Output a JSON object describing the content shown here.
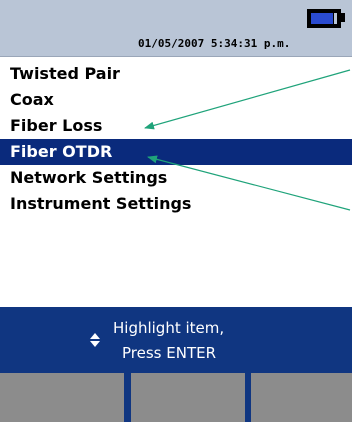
{
  "status_bar": {
    "datetime": "01/05/2007 5:34:31 p.m.",
    "battery_icon": "battery-icon"
  },
  "menu": {
    "items": [
      {
        "label": "Twisted Pair",
        "selected": false
      },
      {
        "label": "Coax",
        "selected": false
      },
      {
        "label": "Fiber Loss",
        "selected": false
      },
      {
        "label": "Fiber OTDR",
        "selected": true
      },
      {
        "label": "Network Settings",
        "selected": false
      },
      {
        "label": "Instrument Settings",
        "selected": false
      }
    ]
  },
  "help": {
    "icon": "up-down-arrows-icon",
    "line1": "Highlight item,",
    "line2": "Press ENTER"
  },
  "softkeys": [
    {
      "label": ""
    },
    {
      "label": ""
    },
    {
      "label": ""
    }
  ],
  "colors": {
    "status_bar_bg": "#b9c5d6",
    "selection": "#0a2a7c",
    "help_panel": "#103681",
    "softkey": "#8c8c8c",
    "callout_line": "#1fa37a"
  }
}
